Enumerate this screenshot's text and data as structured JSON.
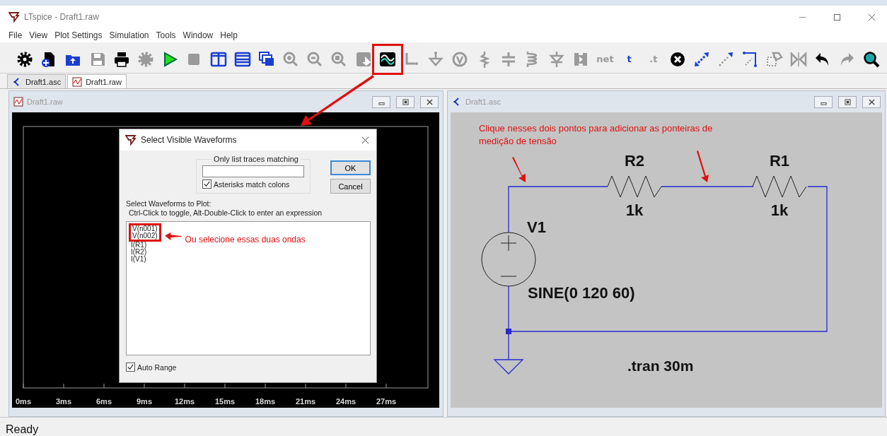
{
  "window": {
    "title": "LTspice - Draft1.raw"
  },
  "menu": [
    "File",
    "View",
    "Plot Settings",
    "Simulation",
    "Tools",
    "Window",
    "Help"
  ],
  "toolbar": [
    {
      "disabled": false,
      "highlighted": false
    },
    {
      "disabled": false,
      "highlighted": false
    },
    {
      "disabled": false,
      "highlighted": false
    },
    {
      "disabled": true,
      "highlighted": false
    },
    {
      "disabled": false,
      "highlighted": false
    },
    {
      "disabled": true,
      "highlighted": false
    },
    {
      "disabled": false,
      "highlighted": false
    },
    {
      "disabled": true,
      "highlighted": false
    },
    {
      "disabled": false,
      "highlighted": false
    },
    {
      "disabled": false,
      "highlighted": false
    },
    {
      "disabled": false,
      "highlighted": false
    },
    {
      "disabled": true,
      "highlighted": false
    },
    {
      "disabled": true,
      "highlighted": false
    },
    {
      "disabled": true,
      "highlighted": false
    },
    {
      "disabled": true,
      "highlighted": false
    },
    {
      "disabled": false,
      "highlighted": true
    },
    {
      "disabled": true,
      "highlighted": false
    },
    {
      "disabled": true,
      "highlighted": false
    },
    {
      "disabled": true,
      "highlighted": false
    },
    {
      "disabled": true,
      "highlighted": false
    },
    {
      "disabled": true,
      "highlighted": false
    },
    {
      "disabled": true,
      "highlighted": false
    },
    {
      "disabled": true,
      "highlighted": false
    },
    {
      "disabled": true,
      "highlighted": false
    },
    {
      "disabled": true,
      "highlighted": false,
      "label": "net"
    },
    {
      "disabled": false,
      "highlighted": false,
      "label": "t"
    },
    {
      "disabled": true,
      "highlighted": false,
      "label": ".t"
    },
    {
      "disabled": false,
      "highlighted": false
    },
    {
      "disabled": false,
      "highlighted": false
    },
    {
      "disabled": false,
      "highlighted": false
    },
    {
      "disabled": false,
      "highlighted": false
    },
    {
      "disabled": true,
      "highlighted": false
    },
    {
      "disabled": true,
      "highlighted": false
    },
    {
      "disabled": false,
      "highlighted": false
    },
    {
      "disabled": true,
      "highlighted": false
    },
    {
      "disabled": false,
      "highlighted": false
    }
  ],
  "doc_tabs": [
    {
      "label": "Draft1.asc",
      "kind": "schematic",
      "selected": false
    },
    {
      "label": "Draft1.raw",
      "kind": "waveform",
      "selected": true
    }
  ],
  "plot_window": {
    "title": "Draft1.raw",
    "x_ticks": [
      "0ms",
      "3ms",
      "6ms",
      "9ms",
      "12ms",
      "15ms",
      "18ms",
      "21ms",
      "24ms",
      "27ms"
    ]
  },
  "dialog": {
    "title": "Select Visible Waveforms",
    "filter_group": "Only list traces matching",
    "options": [
      {
        "label": "Asterisks match colons",
        "checked": true
      }
    ],
    "buttons": [
      {
        "label": "OK",
        "default": true
      },
      {
        "label": "Cancel",
        "default": false
      }
    ],
    "list_heading": "Select Waveforms to Plot:",
    "list_hint": "Ctrl-Click to toggle, Alt-Double-Click to enter an expression",
    "traces": [
      {
        "label": "V(n001)",
        "marked": true
      },
      {
        "label": "V(n002)",
        "marked": true
      },
      {
        "label": "I(R1)",
        "marked": false
      },
      {
        "label": "I(R2)",
        "marked": false
      },
      {
        "label": "I(V1)",
        "marked": false
      }
    ],
    "annotation": "Ou selecione essas duas ondas",
    "auto_range": {
      "label": "Auto Range",
      "checked": true
    }
  },
  "schematic_window": {
    "title": "Draft1.asc",
    "note": "Clique nesses dois pontos para adicionar as ponteiras de medição de tensão",
    "parts": [
      {
        "kind": "resistor",
        "name": "R2",
        "value": "1k"
      },
      {
        "kind": "resistor",
        "name": "R1",
        "value": "1k"
      },
      {
        "kind": "voltage_source",
        "name": "V1",
        "value": "SINE(0 120 60)"
      }
    ],
    "directive": ".tran 30m"
  },
  "status_bar": "Ready"
}
